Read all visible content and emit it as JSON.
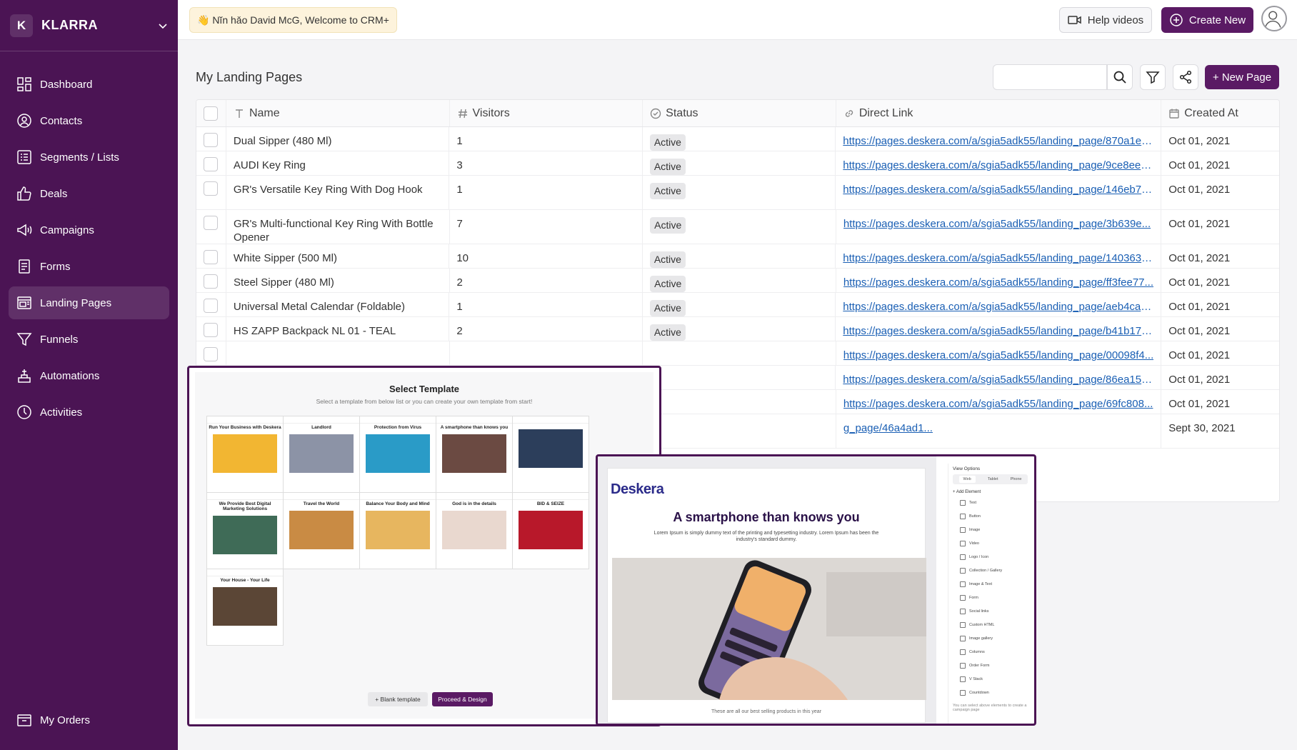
{
  "brand": {
    "initial": "K",
    "name": "KLARRA"
  },
  "sidebar": {
    "items": [
      {
        "label": "Dashboard",
        "icon": "dashboard-icon"
      },
      {
        "label": "Contacts",
        "icon": "contacts-icon"
      },
      {
        "label": "Segments / Lists",
        "icon": "list-icon"
      },
      {
        "label": "Deals",
        "icon": "thumbs-up-icon"
      },
      {
        "label": "Campaigns",
        "icon": "megaphone-icon"
      },
      {
        "label": "Forms",
        "icon": "form-icon"
      },
      {
        "label": "Landing Pages",
        "icon": "landing-page-icon",
        "active": true
      },
      {
        "label": "Funnels",
        "icon": "funnel-icon"
      },
      {
        "label": "Automations",
        "icon": "automation-icon"
      },
      {
        "label": "Activities",
        "icon": "clock-icon"
      }
    ],
    "bottom_item": {
      "label": "My Orders",
      "icon": "orders-icon"
    }
  },
  "topbar": {
    "welcome": "👋 Nĭn hǎo David McG, Welcome to CRM+",
    "help_label": "Help videos",
    "create_label": "Create New"
  },
  "page": {
    "title": "My Landing Pages",
    "search_placeholder": "",
    "new_page_label": "+ New Page"
  },
  "table": {
    "columns": [
      "Name",
      "Visitors",
      "Status",
      "Direct Link",
      "Created At"
    ],
    "rows": [
      {
        "name": "Dual Sipper (480 Ml)",
        "visitors": "1",
        "status": "Active",
        "link": "https://pages.deskera.com/a/sgia5adk55/landing_page/870a1e0...",
        "created": "Oct 01, 2021"
      },
      {
        "name": "AUDI Key Ring",
        "visitors": "3",
        "status": "Active",
        "link": "https://pages.deskera.com/a/sgia5adk55/landing_page/9ce8ee8...",
        "created": "Oct 01, 2021"
      },
      {
        "name": "GR's Versatile Key Ring With Dog Hook",
        "visitors": "1",
        "status": "Active",
        "link": "https://pages.deskera.com/a/sgia5adk55/landing_page/146eb78...",
        "created": "Oct 01, 2021"
      },
      {
        "name": "GR's Multi-functional Key Ring With Bottle Opener",
        "visitors": "7",
        "status": "Active",
        "link": "https://pages.deskera.com/a/sgia5adk55/landing_page/3b639e...",
        "created": "Oct 01, 2021"
      },
      {
        "name": "White Sipper (500 Ml)",
        "visitors": "10",
        "status": "Active",
        "link": "https://pages.deskera.com/a/sgia5adk55/landing_page/140363a...",
        "created": "Oct 01, 2021"
      },
      {
        "name": "Steel Sipper (480 Ml)",
        "visitors": "2",
        "status": "Active",
        "link": "https://pages.deskera.com/a/sgia5adk55/landing_page/ff3fee77...",
        "created": "Oct 01, 2021"
      },
      {
        "name": "Universal Metal Calendar (Foldable)",
        "visitors": "1",
        "status": "Active",
        "link": "https://pages.deskera.com/a/sgia5adk55/landing_page/aeb4cac...",
        "created": "Oct 01, 2021"
      },
      {
        "name": "HS ZAPP Backpack NL 01 - TEAL",
        "visitors": "2",
        "status": "Active",
        "link": "https://pages.deskera.com/a/sgia5adk55/landing_page/b41b178...",
        "created": "Oct 01, 2021"
      },
      {
        "name": "",
        "visitors": "",
        "status": "",
        "link": "https://pages.deskera.com/a/sgia5adk55/landing_page/00098f4...",
        "created": "Oct 01, 2021"
      },
      {
        "name": "",
        "visitors": "",
        "status": "",
        "link": "https://pages.deskera.com/a/sgia5adk55/landing_page/86ea15c...",
        "created": "Oct 01, 2021"
      },
      {
        "name": "",
        "visitors": "",
        "status": "",
        "link": "https://pages.deskera.com/a/sgia5adk55/landing_page/69fc808...",
        "created": "Oct 01, 2021"
      },
      {
        "name": "",
        "visitors": "",
        "status": "",
        "link": "g_page/46a4ad1...",
        "created": "Sept 30, 2021"
      }
    ]
  },
  "select_template": {
    "title": "Select Template",
    "subtitle": "Select a template from below list or you can create your own template from start!",
    "templates": [
      {
        "text": "Run Your Business with Deskera",
        "color": "#f2b632"
      },
      {
        "text": "Landlord",
        "color": "#8c93a6"
      },
      {
        "text": "Protection from Virus",
        "color": "#2a9bc7"
      },
      {
        "text": "A smartphone than knows you",
        "color": "#6b4a42"
      },
      {
        "text": "",
        "color": "#2c3e5b"
      },
      {
        "text": "We Provide Best Digital Marketing Solutions",
        "color": "#3f6b57"
      },
      {
        "text": "Travel the World",
        "color": "#c98b44"
      },
      {
        "text": "Balance Your Body and Mind",
        "color": "#e7b65f"
      },
      {
        "text": "God is in the details",
        "color": "#e9d8cf"
      },
      {
        "text": "BID & SEIZE",
        "color": "#b8182a"
      },
      {
        "text": "Your House - Your Life",
        "color": "#5b4636"
      }
    ],
    "blank_label": "+ Blank template",
    "proceed_label": "Proceed & Design"
  },
  "editor_preview": {
    "logo": "Deskera",
    "headline": "A smartphone than knows you",
    "subtext": "Lorem Ipsum is simply dummy text of the printing and typesetting industry. Lorem Ipsum has been the industry's standard dummy.",
    "footer": "These are all our best selling products in this year",
    "panel": {
      "title": "View Options",
      "tabs": [
        "Web",
        "Tablet",
        "Phone"
      ],
      "add_label": "+ Add Element",
      "elements": [
        "Text",
        "Button",
        "Image",
        "Video",
        "Logo / Icon",
        "Collection / Gallery",
        "Image & Text",
        "Form",
        "Social links",
        "Custom HTML",
        "Image gallery",
        "Columns",
        "Order Form",
        "V Stack",
        "Countdown"
      ],
      "note": "You can select above elements to create a campaign page"
    }
  },
  "colors": {
    "brand": "#4b1454",
    "accent": "#5a1a64",
    "link": "#1a5fb4"
  }
}
